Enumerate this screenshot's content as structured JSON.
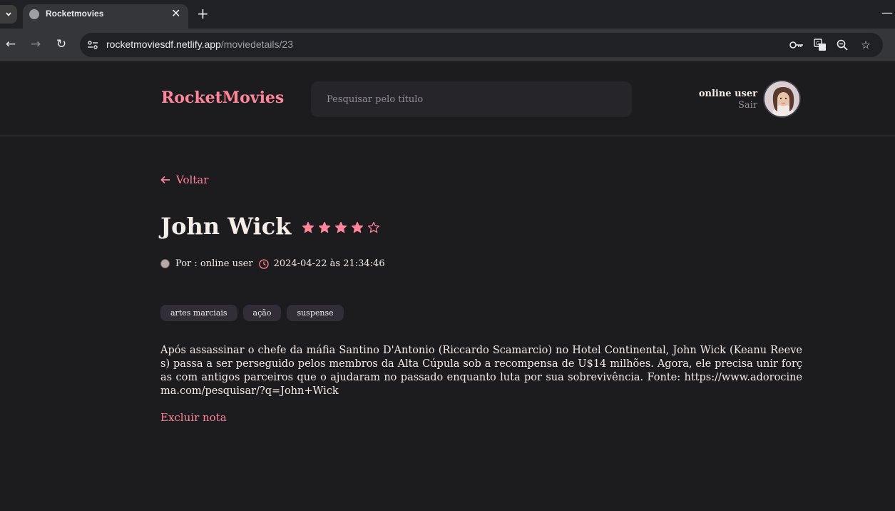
{
  "browser": {
    "tab_title": "Rocketmovies",
    "url_host": "rocketmoviesdf.netlify.app",
    "url_path": "/moviedetails/23"
  },
  "header": {
    "brand": "RocketMovies",
    "search_placeholder": "Pesquisar pelo título",
    "user_name": "online user",
    "logout_label": "Sair"
  },
  "movie": {
    "back_label": "Voltar",
    "title": "John Wick",
    "rating": 4,
    "rating_max": 5,
    "author_label": "Por : online user",
    "created_at": "2024-04-22 às 21:34:46",
    "tags": [
      "artes marciais",
      "ação",
      "suspense"
    ],
    "description": "Após assassinar o chefe da máfia Santino D'Antonio (Riccardo Scamarcio) no Hotel Continental, John Wick (Keanu Reeves) passa a ser perseguido pelos membros da Alta Cúpula sob a recompensa de U$14 milhões. Agora, ele precisa unir forças com antigos parceiros que o ajudaram no passado enquanto luta por sua sobrevivência. Fonte: https://www.adorocinema.com/pesquisar/?q=John+Wick",
    "delete_label": "Excluir nota"
  },
  "colors": {
    "accent": "#ff859b",
    "background": "#1c1b1e",
    "input_bg": "#262529",
    "tag_bg": "#312e38",
    "text": "#f4ede8"
  }
}
